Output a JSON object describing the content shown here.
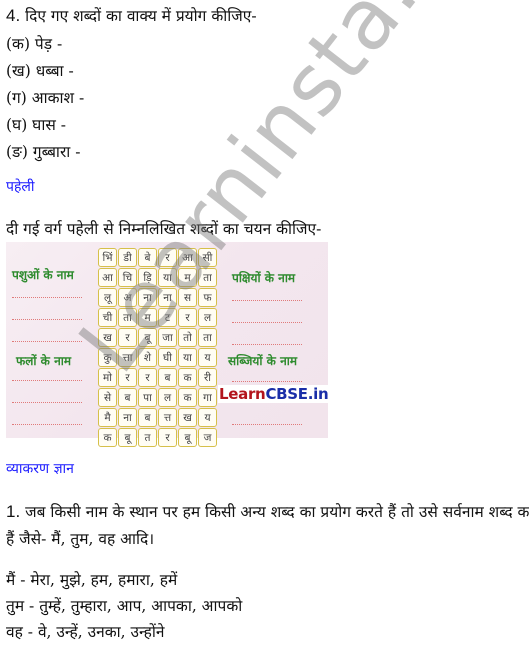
{
  "question4": {
    "number": "4.",
    "title": "दिए गए शब्दों का वाक्य में प्रयोग कीजिए-",
    "items": [
      "(क) पेड़ -",
      "(ख) धब्बा -",
      "(ग) आकाश -",
      "(घ) घास -",
      "(ङ) गुब्बारा -"
    ]
  },
  "puzzle_section": {
    "heading": "पहेली",
    "instruction": "दी गई वर्ग पहेली से निम्नलिखित शब्दों का चयन कीजिए-",
    "categories": {
      "animals": "पशुओं के नाम",
      "fruits": "फलों के नाम",
      "birds": "पक्षियों के नाम",
      "vegetables": "सब्जियों के नाम"
    },
    "grid": [
      [
        "भिं",
        "डी",
        "बे",
        "र",
        "आ",
        "सी"
      ],
      [
        "आ",
        "चि",
        "ड़ि",
        "या",
        "म",
        "ता"
      ],
      [
        "लू",
        "अ",
        "ना",
        "ना",
        "स",
        "फ"
      ],
      [
        "ची",
        "ता",
        "म",
        "ट",
        "र",
        "ल"
      ],
      [
        "ख",
        "र",
        "बू",
        "जा",
        "तो",
        "ता"
      ],
      [
        "कु",
        "त्ता",
        "शे",
        "घी",
        "या",
        "य"
      ],
      [
        "मो",
        "र",
        "र",
        "ब",
        "क",
        "री"
      ],
      [
        "से",
        "ब",
        "पा",
        "ल",
        "क",
        "गा"
      ],
      [
        "मै",
        "ना",
        "ब",
        "त्त",
        "ख",
        "य"
      ],
      [
        "क",
        "बू",
        "त",
        "र",
        "बू",
        "ज"
      ]
    ],
    "brand": {
      "part1": "Learn",
      "part2": "CBSE.in"
    }
  },
  "grammar_section": {
    "heading": "व्याकरण ज्ञान",
    "number": "1.",
    "text_line1": "जब किसी नाम के स्थान पर हम किसी अन्य शब्द का प्रयोग करते हैं तो उसे सर्वनाम शब्द कहते",
    "text_line2": "हैं जैसे- मैं, तुम, वह आदि।",
    "examples": [
      "मैं - मेरा, मुझे, हम, हमारा, हमें",
      "तुम - तुम्हें, तुम्हारा, आप, आपका, आपको",
      "वह - वे, उन्हें, उनका, उन्होंने"
    ]
  },
  "watermark": "Learninsta.com"
}
